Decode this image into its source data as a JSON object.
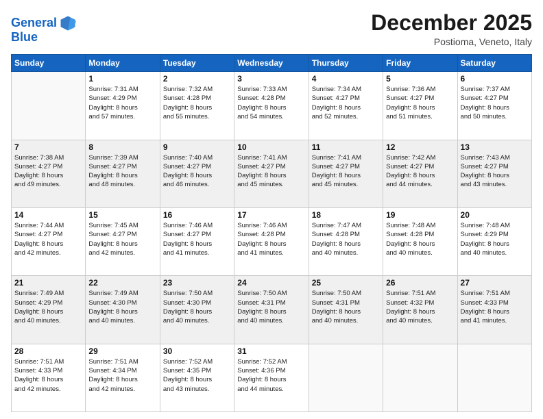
{
  "header": {
    "logo_line1": "General",
    "logo_line2": "Blue",
    "title": "December 2025",
    "subtitle": "Postioma, Veneto, Italy"
  },
  "calendar": {
    "days_of_week": [
      "Sunday",
      "Monday",
      "Tuesday",
      "Wednesday",
      "Thursday",
      "Friday",
      "Saturday"
    ],
    "weeks": [
      [
        {
          "day": "",
          "info": ""
        },
        {
          "day": "1",
          "info": "Sunrise: 7:31 AM\nSunset: 4:29 PM\nDaylight: 8 hours\nand 57 minutes."
        },
        {
          "day": "2",
          "info": "Sunrise: 7:32 AM\nSunset: 4:28 PM\nDaylight: 8 hours\nand 55 minutes."
        },
        {
          "day": "3",
          "info": "Sunrise: 7:33 AM\nSunset: 4:28 PM\nDaylight: 8 hours\nand 54 minutes."
        },
        {
          "day": "4",
          "info": "Sunrise: 7:34 AM\nSunset: 4:27 PM\nDaylight: 8 hours\nand 52 minutes."
        },
        {
          "day": "5",
          "info": "Sunrise: 7:36 AM\nSunset: 4:27 PM\nDaylight: 8 hours\nand 51 minutes."
        },
        {
          "day": "6",
          "info": "Sunrise: 7:37 AM\nSunset: 4:27 PM\nDaylight: 8 hours\nand 50 minutes."
        }
      ],
      [
        {
          "day": "7",
          "info": "Sunrise: 7:38 AM\nSunset: 4:27 PM\nDaylight: 8 hours\nand 49 minutes."
        },
        {
          "day": "8",
          "info": "Sunrise: 7:39 AM\nSunset: 4:27 PM\nDaylight: 8 hours\nand 48 minutes."
        },
        {
          "day": "9",
          "info": "Sunrise: 7:40 AM\nSunset: 4:27 PM\nDaylight: 8 hours\nand 46 minutes."
        },
        {
          "day": "10",
          "info": "Sunrise: 7:41 AM\nSunset: 4:27 PM\nDaylight: 8 hours\nand 45 minutes."
        },
        {
          "day": "11",
          "info": "Sunrise: 7:41 AM\nSunset: 4:27 PM\nDaylight: 8 hours\nand 45 minutes."
        },
        {
          "day": "12",
          "info": "Sunrise: 7:42 AM\nSunset: 4:27 PM\nDaylight: 8 hours\nand 44 minutes."
        },
        {
          "day": "13",
          "info": "Sunrise: 7:43 AM\nSunset: 4:27 PM\nDaylight: 8 hours\nand 43 minutes."
        }
      ],
      [
        {
          "day": "14",
          "info": "Sunrise: 7:44 AM\nSunset: 4:27 PM\nDaylight: 8 hours\nand 42 minutes."
        },
        {
          "day": "15",
          "info": "Sunrise: 7:45 AM\nSunset: 4:27 PM\nDaylight: 8 hours\nand 42 minutes."
        },
        {
          "day": "16",
          "info": "Sunrise: 7:46 AM\nSunset: 4:27 PM\nDaylight: 8 hours\nand 41 minutes."
        },
        {
          "day": "17",
          "info": "Sunrise: 7:46 AM\nSunset: 4:28 PM\nDaylight: 8 hours\nand 41 minutes."
        },
        {
          "day": "18",
          "info": "Sunrise: 7:47 AM\nSunset: 4:28 PM\nDaylight: 8 hours\nand 40 minutes."
        },
        {
          "day": "19",
          "info": "Sunrise: 7:48 AM\nSunset: 4:28 PM\nDaylight: 8 hours\nand 40 minutes."
        },
        {
          "day": "20",
          "info": "Sunrise: 7:48 AM\nSunset: 4:29 PM\nDaylight: 8 hours\nand 40 minutes."
        }
      ],
      [
        {
          "day": "21",
          "info": "Sunrise: 7:49 AM\nSunset: 4:29 PM\nDaylight: 8 hours\nand 40 minutes."
        },
        {
          "day": "22",
          "info": "Sunrise: 7:49 AM\nSunset: 4:30 PM\nDaylight: 8 hours\nand 40 minutes."
        },
        {
          "day": "23",
          "info": "Sunrise: 7:50 AM\nSunset: 4:30 PM\nDaylight: 8 hours\nand 40 minutes."
        },
        {
          "day": "24",
          "info": "Sunrise: 7:50 AM\nSunset: 4:31 PM\nDaylight: 8 hours\nand 40 minutes."
        },
        {
          "day": "25",
          "info": "Sunrise: 7:50 AM\nSunset: 4:31 PM\nDaylight: 8 hours\nand 40 minutes."
        },
        {
          "day": "26",
          "info": "Sunrise: 7:51 AM\nSunset: 4:32 PM\nDaylight: 8 hours\nand 40 minutes."
        },
        {
          "day": "27",
          "info": "Sunrise: 7:51 AM\nSunset: 4:33 PM\nDaylight: 8 hours\nand 41 minutes."
        }
      ],
      [
        {
          "day": "28",
          "info": "Sunrise: 7:51 AM\nSunset: 4:33 PM\nDaylight: 8 hours\nand 42 minutes."
        },
        {
          "day": "29",
          "info": "Sunrise: 7:51 AM\nSunset: 4:34 PM\nDaylight: 8 hours\nand 42 minutes."
        },
        {
          "day": "30",
          "info": "Sunrise: 7:52 AM\nSunset: 4:35 PM\nDaylight: 8 hours\nand 43 minutes."
        },
        {
          "day": "31",
          "info": "Sunrise: 7:52 AM\nSunset: 4:36 PM\nDaylight: 8 hours\nand 44 minutes."
        },
        {
          "day": "",
          "info": ""
        },
        {
          "day": "",
          "info": ""
        },
        {
          "day": "",
          "info": ""
        }
      ]
    ]
  }
}
